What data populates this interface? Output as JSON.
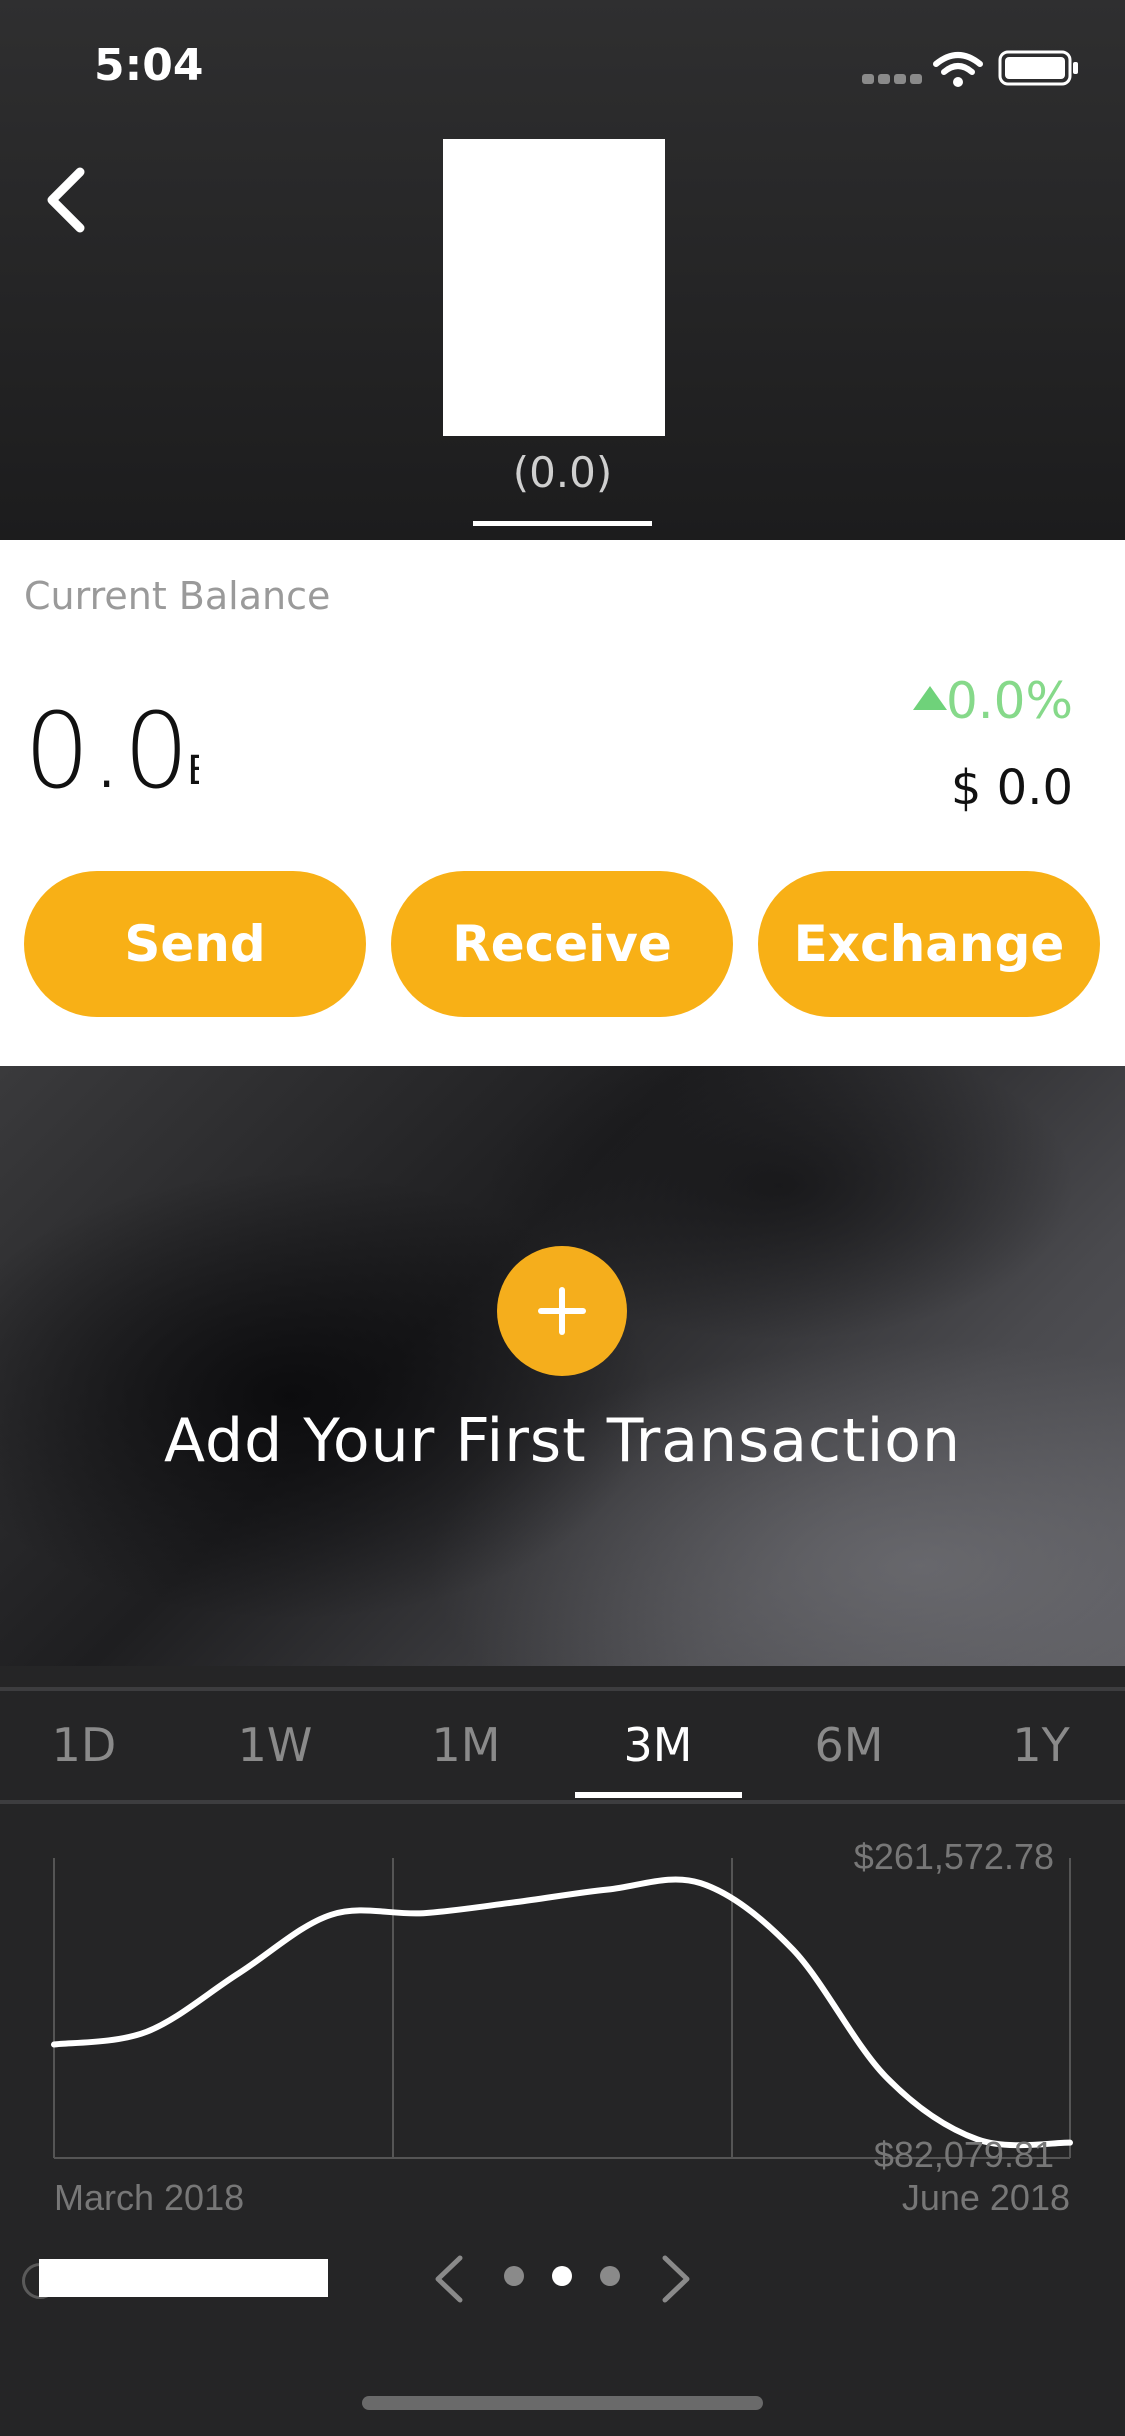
{
  "status_bar": {
    "time": "5:04"
  },
  "header": {
    "coin_amount": "(0.0)"
  },
  "balance": {
    "label": "Current Balance",
    "value": "0.0",
    "unit": "B",
    "change": "0.0%",
    "usd": "$ 0.0"
  },
  "actions": {
    "send": "Send",
    "receive": "Receive",
    "exchange": "Exchange"
  },
  "banner": {
    "text": "Add Your First Transaction"
  },
  "tabs": [
    "1D",
    "1W",
    "1M",
    "3M",
    "6M",
    "1Y"
  ],
  "active_tab": "3M",
  "chart_data": {
    "type": "line",
    "y_max_label": "$261,572.78",
    "y_min_label": "$82,079.81",
    "x_start_label": "March 2018",
    "x_end_label": "June 2018",
    "ylim": [
      82079.81,
      261572.78
    ],
    "grid": true,
    "series": [
      {
        "values": [
          150000,
          158000,
          195000,
          232000,
          233000,
          240000,
          248000,
          252000,
          210000,
          130000,
          90000,
          88000
        ]
      }
    ]
  },
  "pager": {
    "pages": 3,
    "active_index": 1
  },
  "colors": {
    "accent": "#f8b016",
    "positive": "#86d98a",
    "background": "#252526"
  }
}
